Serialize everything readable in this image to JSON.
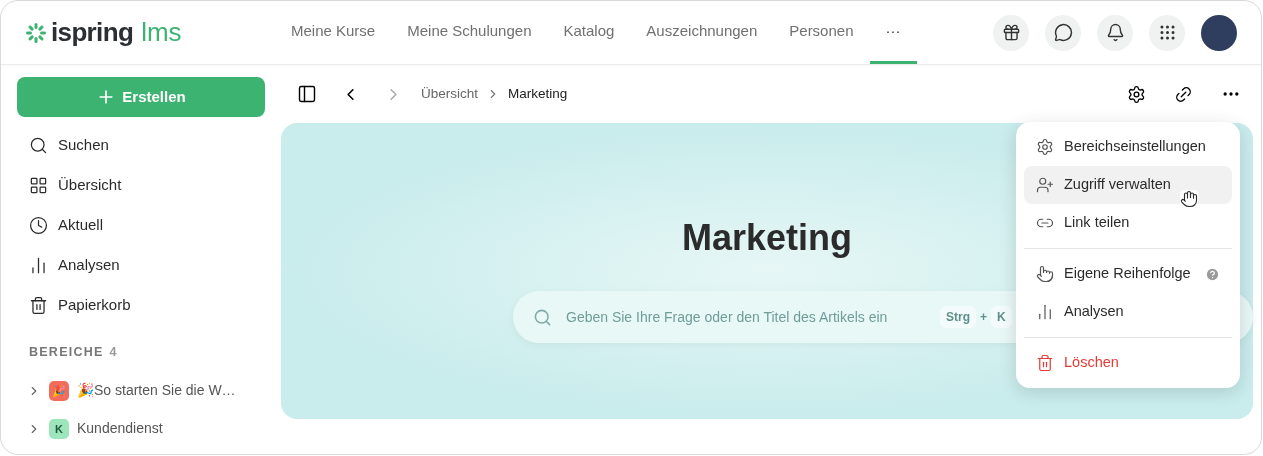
{
  "logo": {
    "name": "ispring",
    "suffix": "lms"
  },
  "nav": [
    {
      "label": "Meine Kurse",
      "selected": false
    },
    {
      "label": "Meine Schulungen",
      "selected": false
    },
    {
      "label": "Katalog",
      "selected": false
    },
    {
      "label": "Auszeichnungen",
      "selected": false
    },
    {
      "label": "Personen",
      "selected": false
    },
    {
      "label": "···",
      "selected": true
    }
  ],
  "create_button": "Erstellen",
  "sidebar": {
    "items": [
      {
        "label": "Suchen"
      },
      {
        "label": "Übersicht"
      },
      {
        "label": "Aktuell"
      },
      {
        "label": "Analysen"
      },
      {
        "label": "Papierkorb"
      }
    ],
    "section": {
      "title": "BEREICHE",
      "count": "4"
    },
    "spaces": [
      {
        "avatar": "🎉",
        "label": "🎉So starten Sie die W…",
        "color": "#f26b5b"
      },
      {
        "avatar": "K",
        "label": "Kundendienst",
        "color": "#9de5bb"
      }
    ]
  },
  "breadcrumb": [
    "Übersicht",
    "Marketing"
  ],
  "hero": {
    "title": "Marketing",
    "search": {
      "placeholder": "Geben Sie Ihre Frage oder den Titel des Artikels ein",
      "keys": [
        "Strg",
        "+",
        "K"
      ]
    }
  },
  "menu": {
    "groups": [
      [
        {
          "label": "Bereichseinstellungen",
          "kind": "item",
          "selected": false,
          "help": false
        },
        {
          "label": "Zugriff verwalten",
          "kind": "item",
          "selected": true,
          "help": false
        },
        {
          "label": "Link teilen",
          "kind": "item",
          "selected": false,
          "help": false
        }
      ],
      [
        {
          "label": "Eigene Reihenfolge",
          "kind": "item",
          "selected": false,
          "help": true
        },
        {
          "label": "Analysen",
          "kind": "item",
          "selected": false,
          "help": false
        }
      ],
      [
        {
          "label": "Löschen",
          "kind": "danger",
          "selected": false,
          "help": false
        }
      ]
    ]
  }
}
